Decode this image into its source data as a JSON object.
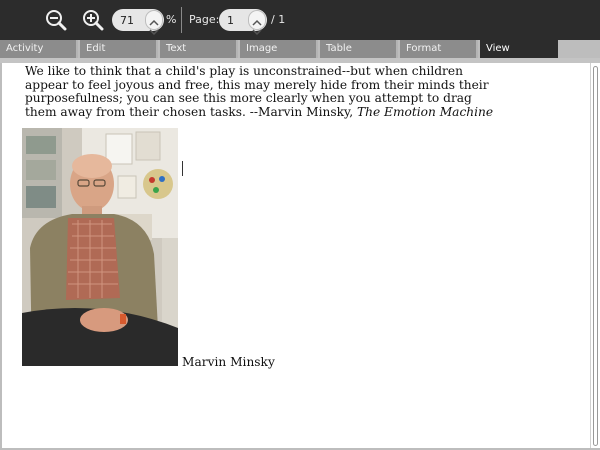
{
  "toolbar": {
    "zoom_value": "71",
    "zoom_unit": "%",
    "page_label": "Page:",
    "page_value": "1",
    "page_total": "/ 1",
    "icons": [
      "zoom-out-icon",
      "zoom-in-icon"
    ]
  },
  "tabs": [
    {
      "label": "Activity"
    },
    {
      "label": "Edit"
    },
    {
      "label": "Text"
    },
    {
      "label": "Image"
    },
    {
      "label": "Table"
    },
    {
      "label": "Format"
    },
    {
      "label": "View",
      "active": true
    }
  ],
  "document": {
    "quote_lines": [
      "We like to think that a child's play is unconstrained--but when children",
      "appear to feel joyous and free, this may merely hide from their minds their",
      "purposefulness; you can see this more clearly when you attempt to drag",
      "them away from their chosen tasks. --Marvin Minsky, "
    ],
    "quote_source": "The Emotion Machine",
    "caption": "Marvin Minsky"
  },
  "colors": {
    "toolbar_bg": "#2c2c2c",
    "tab_bg": "#8c8c8c",
    "tab_active_bg": "#2c2c2c",
    "document_bg": "#ffffff"
  }
}
